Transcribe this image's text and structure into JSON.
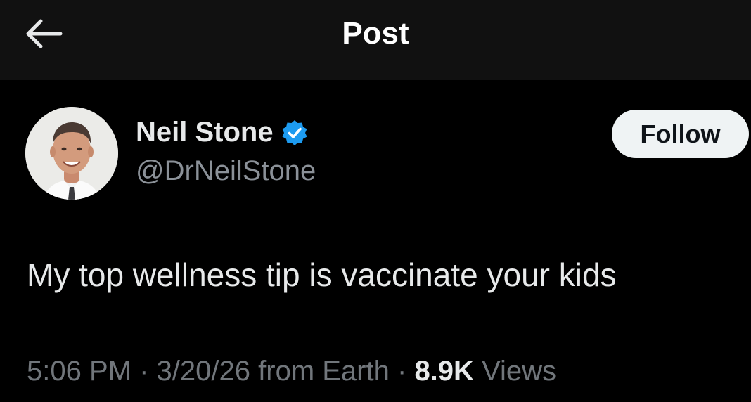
{
  "header": {
    "title": "Post",
    "back_icon": "arrow-left-icon"
  },
  "author": {
    "name": "Neil Stone",
    "handle": "@DrNeilStone",
    "verified": true,
    "verified_color": "#1d9bf0"
  },
  "follow_button": {
    "label": "Follow"
  },
  "post": {
    "text": "My top wellness tip is vaccinate your kids"
  },
  "meta": {
    "time": "5:06 PM",
    "separator": "·",
    "date": "3/20/26",
    "source": "from Earth",
    "views_count": "8.9K",
    "views_label": "Views"
  },
  "colors": {
    "background": "#000000",
    "header_background": "#111111",
    "text_primary": "#e7e9ea",
    "text_secondary": "#71767b",
    "accent": "#1d9bf0"
  }
}
